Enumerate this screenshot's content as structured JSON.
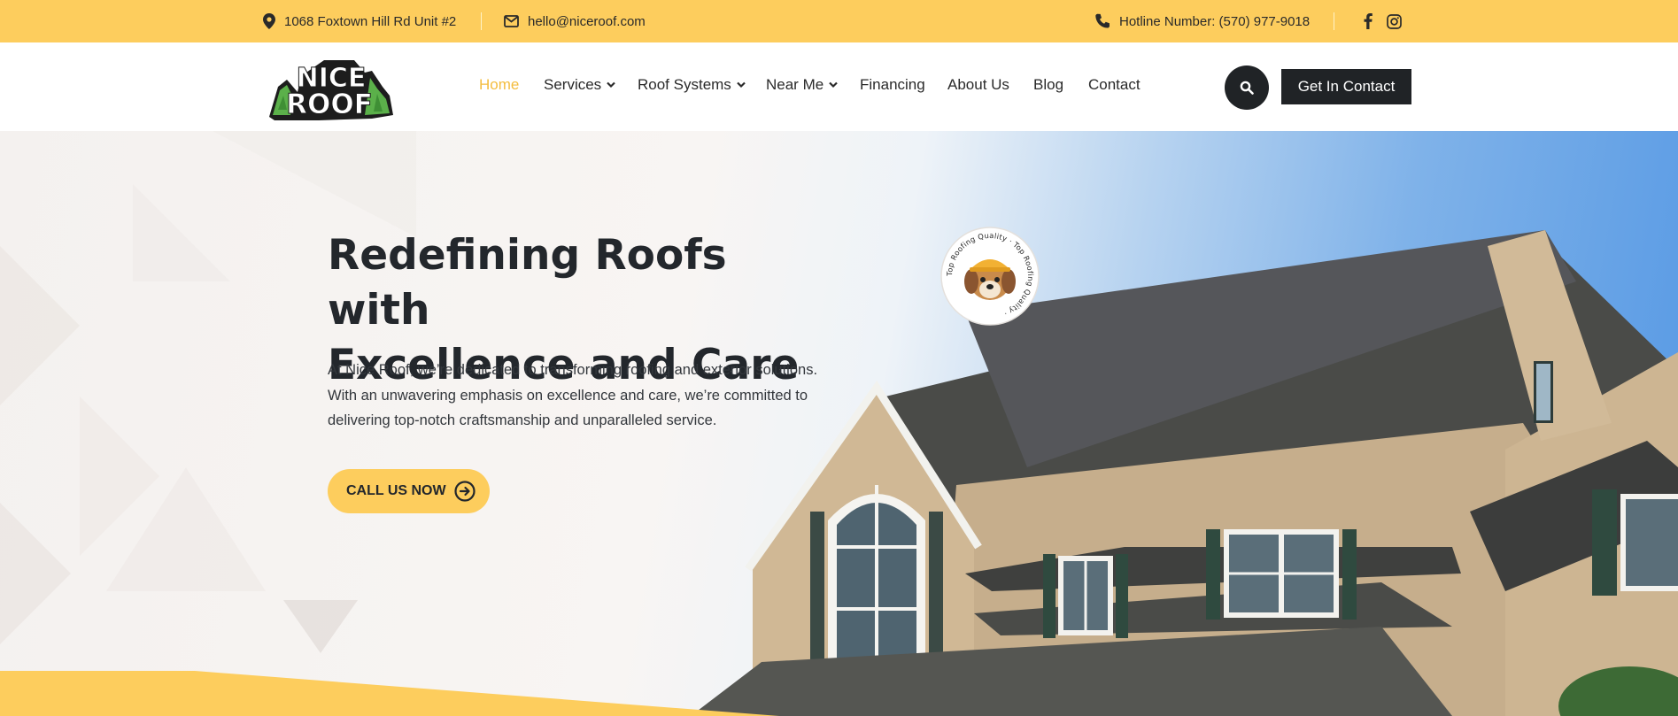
{
  "topbar": {
    "address": "1068 Foxtown Hill Rd Unit #2",
    "email": "hello@niceroof.com",
    "hotline": "Hotline Number: (570) 977-9018",
    "social": [
      "facebook-icon",
      "instagram-icon"
    ]
  },
  "header": {
    "logo": {
      "line1": "NICE",
      "line2": "ROOF"
    },
    "nav": [
      {
        "label": "Home",
        "active": true,
        "dropdown": false
      },
      {
        "label": "Services",
        "dropdown": true
      },
      {
        "label": "Roof Systems",
        "dropdown": true
      },
      {
        "label": "Near Me",
        "dropdown": true
      },
      {
        "label": "Financing",
        "dropdown": false
      },
      {
        "label": "About Us",
        "dropdown": false
      },
      {
        "label": "Blog",
        "dropdown": false
      },
      {
        "label": "Contact",
        "dropdown": false
      }
    ],
    "search_icon": "search-icon",
    "cta_label": "Get In Contact"
  },
  "hero": {
    "title_line1": "Redefining Roofs with",
    "title_line2": "Excellence and Care",
    "text_line1": "At Nice Roof, we’re dedicated to transforming roofing and exterior solutions.",
    "text_line2": "With an unwavering emphasis on excellence and care, we’re committed to",
    "text_line3": "delivering top-notch craftsmanship and unparalleled service.",
    "button_label": "CALL US NOW",
    "badge_text": "Top Roofing Quality · Top Roofing Quality ·"
  },
  "colors": {
    "accent": "#fdcd5d",
    "accent_text": "#f4bd3f",
    "dark": "#202326",
    "sky": "#5598e4"
  }
}
